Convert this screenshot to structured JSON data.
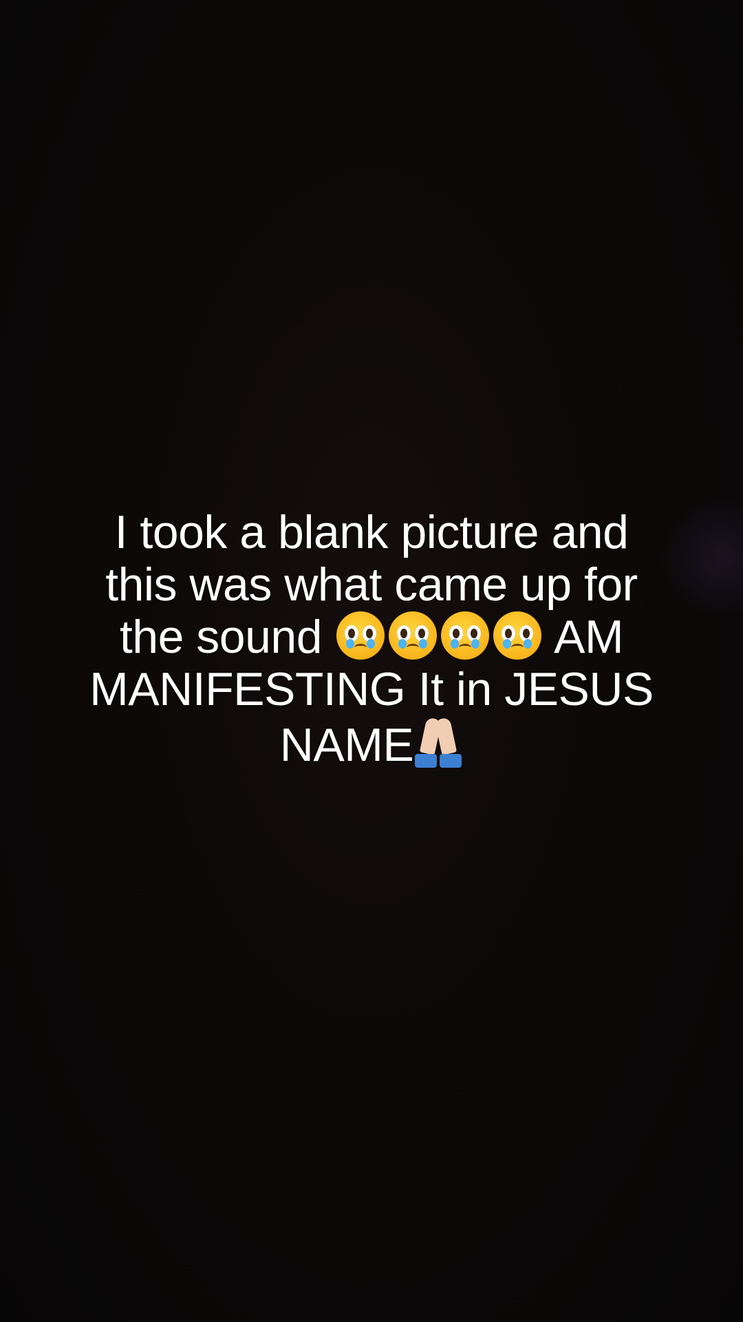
{
  "caption": {
    "line1": "I took a blank picture and",
    "line2": "this was what came up for",
    "line3_text": "the sound",
    "line3_after": "AM",
    "line4": "MANIFESTING It in JESUS",
    "line5": "NAME"
  },
  "emoji": {
    "faces": [
      "pleading-face-icon",
      "pleading-face-icon",
      "pleading-face-icon",
      "pleading-face-icon"
    ],
    "hands": "folded-hands-icon"
  },
  "colors": {
    "background": "#0c0808",
    "text": "#ffffff"
  }
}
